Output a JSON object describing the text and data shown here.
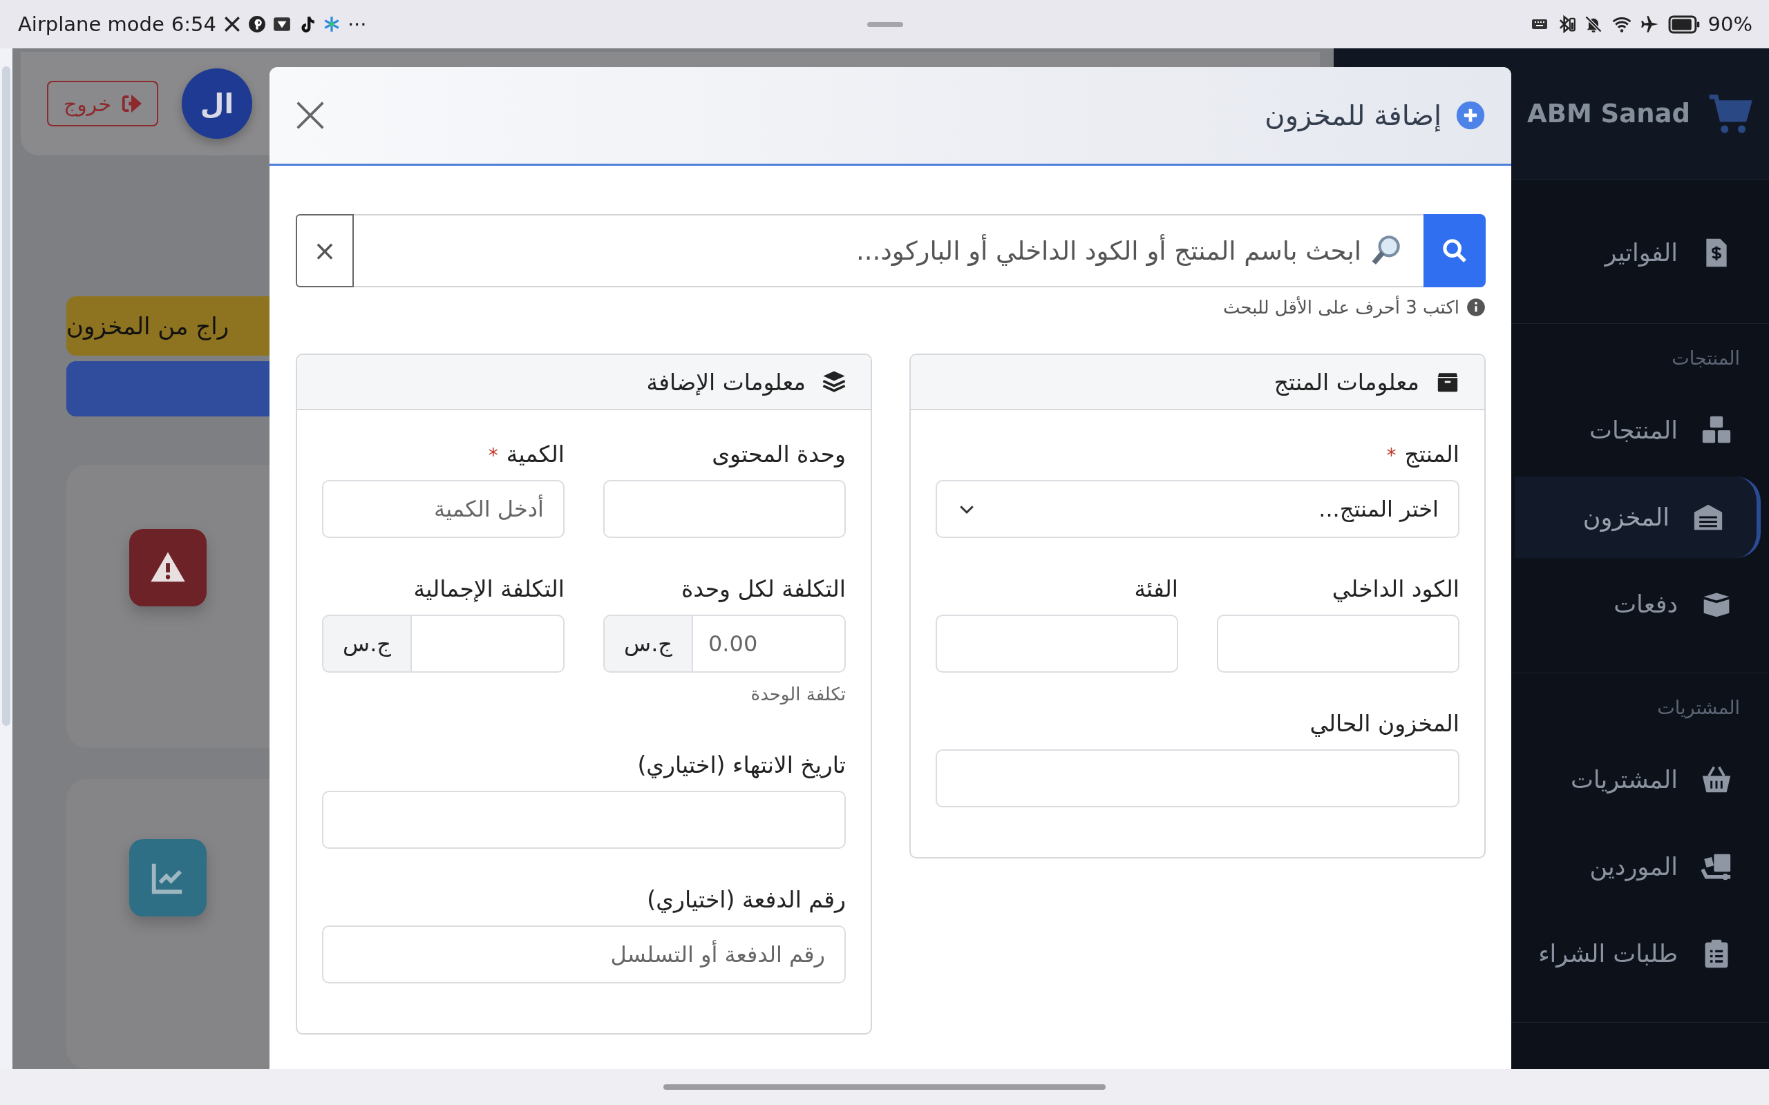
{
  "status_bar": {
    "mode": "Airplane mode",
    "time": "6:54",
    "more": "···",
    "battery": "90%"
  },
  "background": {
    "logout_button": "خروج",
    "avatar": "ال",
    "stock_out_button": "راج من المخزون"
  },
  "sidebar": {
    "brand": "ABM Sanad",
    "groups": [
      {
        "items": [
          {
            "label": "الفواتير",
            "selected": false
          }
        ]
      },
      {
        "heading": "المنتجات",
        "items": [
          {
            "label": "المنتجات",
            "selected": false
          },
          {
            "label": "المخزون",
            "selected": true
          },
          {
            "label": "دفعات",
            "selected": false
          }
        ]
      },
      {
        "heading": "المشتريات",
        "items": [
          {
            "label": "المشتريات",
            "selected": false
          },
          {
            "label": "الموردين",
            "selected": false
          },
          {
            "label": "طلبات الشراء",
            "selected": false
          }
        ]
      }
    ]
  },
  "modal": {
    "title": "إضافة للمخزون",
    "search": {
      "placeholder": "ابحث باسم المنتج أو الكود الداخلي أو الباركود...",
      "clear": "×",
      "hint": "اكتب 3 أحرف على الأقل للبحث"
    },
    "cards": [
      {
        "title": "معلومات المنتج",
        "rows": [
          [
            {
              "label": "المنتج",
              "required_mark": "*",
              "kind": "select",
              "value": "اختر المنتج..."
            }
          ],
          [
            {
              "label": "الكود الداخلي",
              "kind": "text"
            },
            {
              "label": "الفئة",
              "kind": "text"
            }
          ],
          [
            {
              "label": "المخزون الحالي",
              "kind": "text"
            }
          ]
        ]
      },
      {
        "title": "معلومات الإضافة",
        "rows": [
          [
            {
              "label": "وحدة المحتوى",
              "kind": "text"
            },
            {
              "label": "الكمية",
              "required_mark": "*",
              "kind": "text",
              "placeholder": "أدخل الكمية"
            }
          ],
          [
            {
              "label": "التكلفة لكل وحدة",
              "kind": "money",
              "placeholder": "0.00",
              "addon": "ج.س",
              "help": "تكلفة الوحدة"
            },
            {
              "label": "التكلفة الإجمالية",
              "kind": "money",
              "addon": "ج.س"
            }
          ],
          [
            {
              "label": "تاريخ الانتهاء (اختياري)",
              "kind": "text"
            }
          ],
          [
            {
              "label": "رقم الدفعة (اختياري)",
              "kind": "text",
              "placeholder": "رقم الدفعة أو التسلسل"
            }
          ]
        ]
      }
    ]
  }
}
